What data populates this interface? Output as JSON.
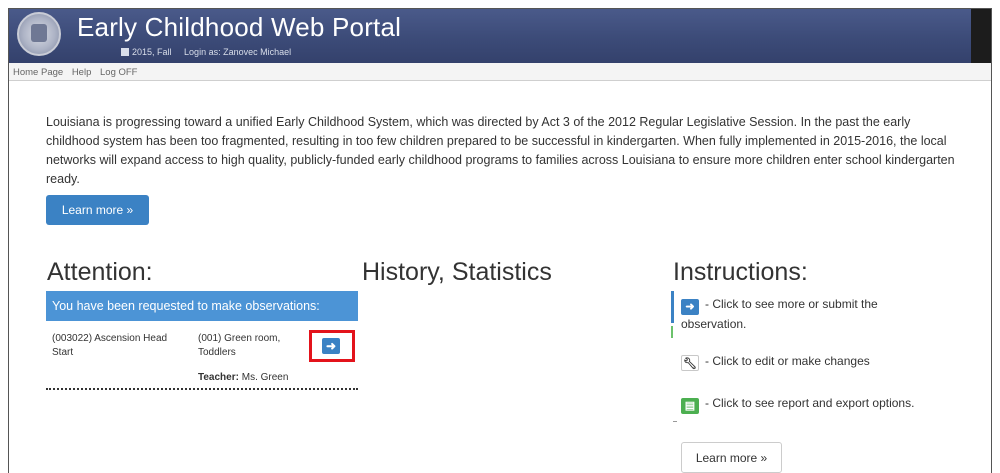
{
  "header": {
    "title": "Early Childhood Web Portal",
    "term": "2015, Fall",
    "login": "Login as: Zanovec Michael"
  },
  "menu": [
    "Home Page",
    "Help",
    "Log OFF"
  ],
  "intro": {
    "text": "Louisiana is progressing toward a unified Early Childhood System, which was directed by Act 3 of the 2012 Regular Legislative Session. In the past the early childhood system has been too fragmented, resulting in too few children prepared to be successful in kindergarten. When fully implemented in 2015-2016, the local networks will expand access to high quality, publicly-funded early childhood programs to families across Louisiana to ensure more children enter school kindergarten ready.",
    "learn_more": "Learn more »"
  },
  "attention": {
    "title": "Attention:",
    "banner": "You have been requested to make observations:",
    "row": {
      "site": "(003022) Ascension Head Start",
      "room": "(001) Green room, Toddlers",
      "teacher_label": "Teacher:",
      "teacher_name": "Ms. Green"
    }
  },
  "history": {
    "title": "History, Statistics"
  },
  "instructions": {
    "title": "Instructions:",
    "items": [
      {
        "icon": "arrow-right-icon",
        "text": "- Click to see more or submit the observation."
      },
      {
        "icon": "wrench-icon",
        "text": "- Click to edit or make changes"
      },
      {
        "icon": "report-icon",
        "text": "- Click to see report and export options."
      }
    ],
    "learn_more": "Learn more »"
  },
  "colors": {
    "header": "#3c4b78",
    "primary": "#3b82c4",
    "banner": "#4c94d6",
    "highlight": "#e3131b",
    "success": "#4caf50"
  }
}
